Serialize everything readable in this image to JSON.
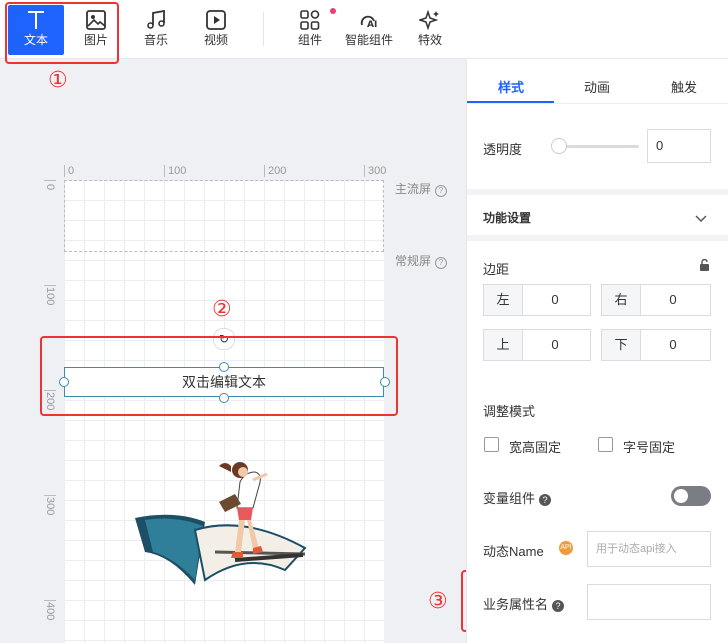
{
  "toolbar": {
    "tools": [
      {
        "label": "文本",
        "icon": "text-icon"
      },
      {
        "label": "图片",
        "icon": "image-icon"
      },
      {
        "label": "音乐",
        "icon": "music-icon"
      },
      {
        "label": "视频",
        "icon": "video-icon"
      },
      {
        "label": "组件",
        "icon": "components-icon"
      },
      {
        "label": "智能组件",
        "icon": "ai-components-icon"
      },
      {
        "label": "特效",
        "icon": "sparkle-icon"
      }
    ],
    "accent": "#1f63ff"
  },
  "annotations": [
    "①",
    "②",
    "③"
  ],
  "canvas": {
    "ruler_top": [
      "0",
      "100",
      "200",
      "300"
    ],
    "ruler_left": [
      "0",
      "100",
      "200",
      "300",
      "400"
    ],
    "first_screen_label": "主流屏",
    "normal_screen_label": "常规屏",
    "text_element": "双击编辑文本"
  },
  "panel": {
    "tabs": [
      "样式",
      "动画",
      "触发"
    ],
    "opacity_label": "透明度",
    "opacity_value": "0",
    "section_title": "功能设置",
    "margin_label": "边距",
    "margins": [
      {
        "side": "左",
        "value": "0"
      },
      {
        "side": "右",
        "value": "0"
      },
      {
        "side": "上",
        "value": "0"
      },
      {
        "side": "下",
        "value": "0"
      }
    ],
    "adjust_mode_label": "调整模式",
    "fixed_wh_label": "宽高固定",
    "fixed_font_label": "字号固定",
    "variable_component_label": "变量组件",
    "dynamic_name_label": "动态Name",
    "dynamic_name_placeholder": "用于动态api接入",
    "api_badge": "API",
    "business_attr_label": "业务属性名",
    "business_attr_value": ""
  }
}
